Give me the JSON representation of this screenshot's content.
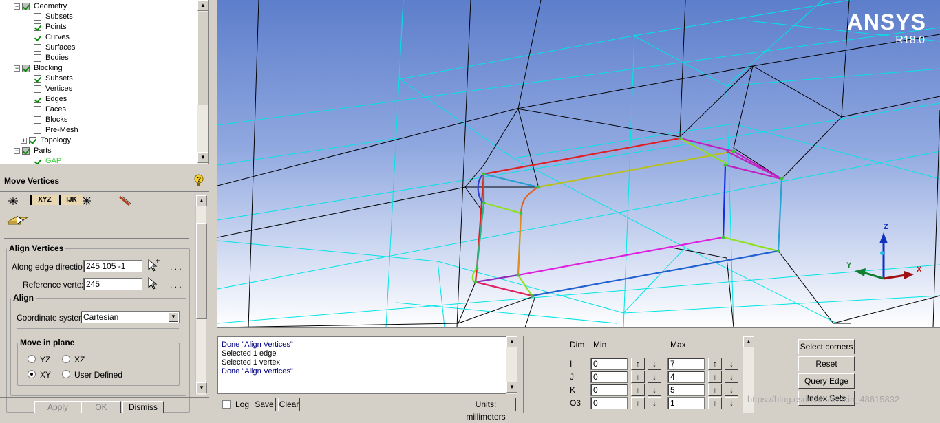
{
  "tree": {
    "items": [
      {
        "label": "Geometry",
        "level": 0,
        "check": "gray",
        "expander": "−"
      },
      {
        "label": "Subsets",
        "level": 1,
        "check": "off"
      },
      {
        "label": "Points",
        "level": 1,
        "check": "on"
      },
      {
        "label": "Curves",
        "level": 1,
        "check": "on"
      },
      {
        "label": "Surfaces",
        "level": 1,
        "check": "off"
      },
      {
        "label": "Bodies",
        "level": 1,
        "check": "off"
      },
      {
        "label": "Blocking",
        "level": 0,
        "check": "gray",
        "expander": "−"
      },
      {
        "label": "Subsets",
        "level": 1,
        "check": "on"
      },
      {
        "label": "Vertices",
        "level": 1,
        "check": "off"
      },
      {
        "label": "Edges",
        "level": 1,
        "check": "on"
      },
      {
        "label": "Faces",
        "level": 1,
        "check": "off"
      },
      {
        "label": "Blocks",
        "level": 1,
        "check": "off"
      },
      {
        "label": "Pre-Mesh",
        "level": 1,
        "check": "off"
      },
      {
        "label": "Topology",
        "level": 1,
        "check": "on",
        "expander": "+"
      },
      {
        "label": "Parts",
        "level": 0,
        "check": "gray",
        "expander": "−"
      },
      {
        "label": "GAP",
        "level": 1,
        "check": "on"
      }
    ]
  },
  "panel": {
    "title": "Move Vertices",
    "toolbar_xyz": "XYZ",
    "toolbar_ijk": "IJK",
    "align_vertices_legend": "Align Vertices",
    "along_edge_label": "Along edge direction",
    "along_edge_value": "245 105 -1",
    "ref_vertex_label": "Reference vertex",
    "ref_vertex_value": "245",
    "dots": ". . .",
    "align_legend": "Align",
    "coord_label": "Coordinate system",
    "coord_value": "Cartesian",
    "move_plane_legend": "Move in plane",
    "radio_yz": "YZ",
    "radio_xz": "XZ",
    "radio_xy": "XY",
    "radio_user": "User Defined",
    "selected_plane": "XY",
    "apply": "Apply",
    "ok": "OK",
    "dismiss": "Dismiss"
  },
  "viewport": {
    "brand": "ANSYS",
    "version": "R18.0",
    "axis_x": "X",
    "axis_y": "Y",
    "axis_z": "Z"
  },
  "messages": {
    "lines": [
      {
        "text": "Done \"Align Vertices\"",
        "blue": true
      },
      {
        "text": "Selected 1 edge",
        "blue": false
      },
      {
        "text": "Selected 1 vertex",
        "blue": false
      },
      {
        "text": "Done \"Align Vertices\"",
        "blue": true
      }
    ],
    "log_label": "Log",
    "save": "Save",
    "clear": "Clear",
    "units": "Units: millimeters"
  },
  "dims": {
    "col_dim": "Dim",
    "col_min": "Min",
    "col_max": "Max",
    "rows": [
      {
        "dim": "I",
        "min": "0",
        "max": "7"
      },
      {
        "dim": "J",
        "min": "0",
        "max": "4"
      },
      {
        "dim": "K",
        "min": "0",
        "max": "5"
      },
      {
        "dim": "O3",
        "min": "0",
        "max": "1"
      }
    ]
  },
  "right_buttons": {
    "select_corners": "Select corners",
    "reset": "Reset",
    "query_edge": "Query Edge",
    "index_sets": "Index Sets"
  },
  "watermark": "https://blog.csdn.net/weixin_48615832",
  "colors": {
    "ansys_text": "#ffffff",
    "mesh_cyan": "#00e5e5",
    "background_top": "#5d7ecb"
  }
}
